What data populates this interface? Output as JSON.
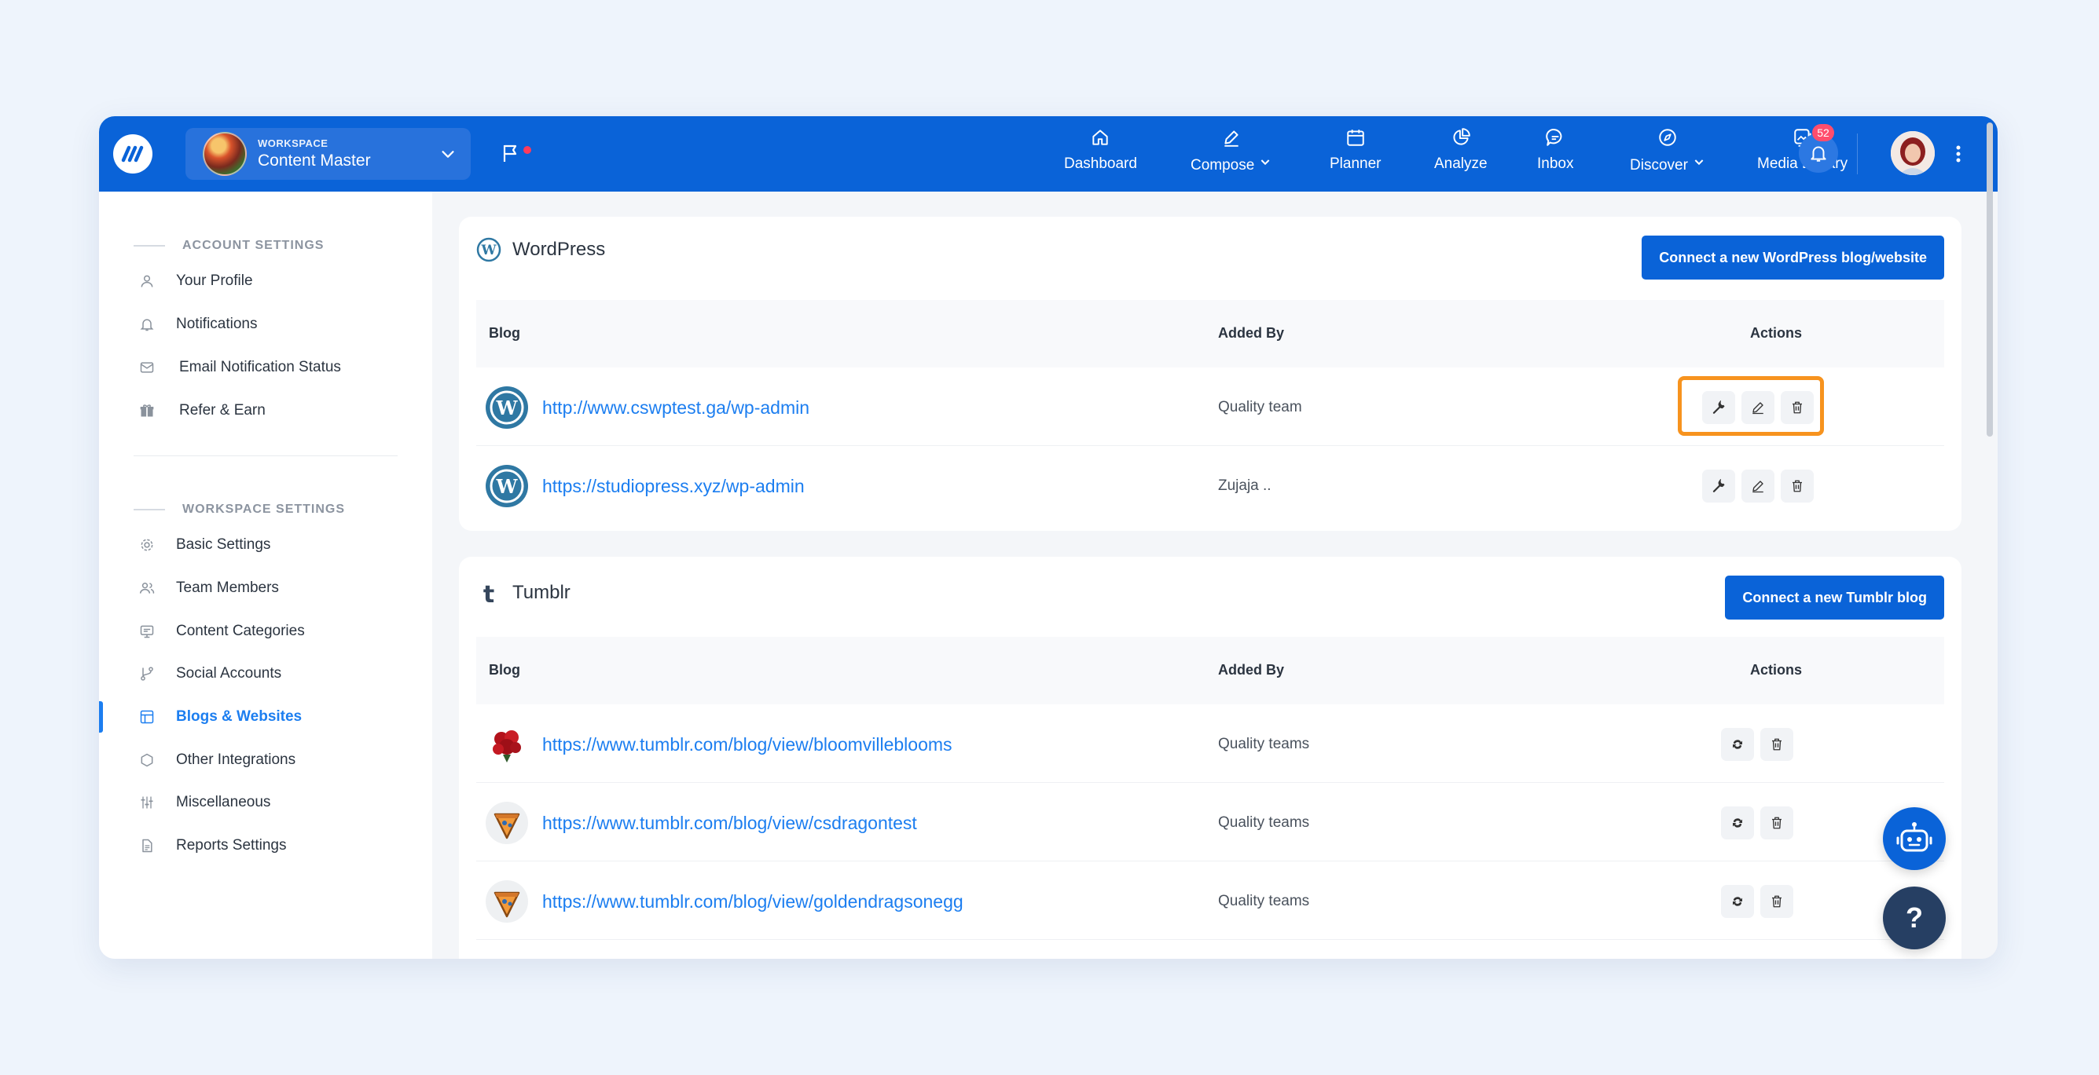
{
  "topbar": {
    "workspace_label": "WORKSPACE",
    "workspace_name": "Content Master",
    "nav": [
      {
        "label": "Dashboard",
        "icon": "home-icon"
      },
      {
        "label": "Compose",
        "icon": "pen-icon",
        "dropdown": true
      },
      {
        "label": "Planner",
        "icon": "calendar-icon"
      },
      {
        "label": "Analyze",
        "icon": "pie-chart-icon"
      },
      {
        "label": "Inbox",
        "icon": "chat-bubble-icon"
      },
      {
        "label": "Discover",
        "icon": "compass-icon",
        "dropdown": true
      },
      {
        "label": "Media Library",
        "icon": "images-icon"
      }
    ],
    "notifications_count": "52"
  },
  "sidebar": {
    "account_heading": "ACCOUNT SETTINGS",
    "account_items": [
      {
        "label": "Your Profile",
        "icon": "user-icon"
      },
      {
        "label": "Notifications",
        "icon": "bell-icon"
      },
      {
        "label": "Email Notification Status",
        "icon": "mail-icon"
      },
      {
        "label": "Refer & Earn",
        "icon": "gift-icon"
      }
    ],
    "workspace_heading": "WORKSPACE SETTINGS",
    "workspace_items": [
      {
        "label": "Basic Settings",
        "icon": "gear-icon"
      },
      {
        "label": "Team Members",
        "icon": "users-icon"
      },
      {
        "label": "Content Categories",
        "icon": "category-icon"
      },
      {
        "label": "Social Accounts",
        "icon": "branch-icon"
      },
      {
        "label": "Blogs & Websites",
        "icon": "layout-icon",
        "active": true
      },
      {
        "label": "Other Integrations",
        "icon": "hexagon-icon"
      },
      {
        "label": "Miscellaneous",
        "icon": "sliders-icon"
      },
      {
        "label": "Reports Settings",
        "icon": "document-icon"
      }
    ]
  },
  "wordpress": {
    "title": "WordPress",
    "connect_label": "Connect a new WordPress blog/website",
    "col_blog": "Blog",
    "col_added_by": "Added By",
    "col_actions": "Actions",
    "rows": [
      {
        "url": "http://www.cswptest.ga/wp-admin",
        "added_by": "Quality team"
      },
      {
        "url": "https://studiopress.xyz/wp-admin",
        "added_by": "Zujaja .."
      }
    ]
  },
  "tumblr": {
    "title": "Tumblr",
    "connect_label": "Connect a new Tumblr blog",
    "col_blog": "Blog",
    "col_added_by": "Added By",
    "col_actions": "Actions",
    "rows": [
      {
        "url": "https://www.tumblr.com/blog/view/bloomvilleblooms",
        "added_by": "Quality teams"
      },
      {
        "url": "https://www.tumblr.com/blog/view/csdragontest",
        "added_by": "Quality teams"
      },
      {
        "url": "https://www.tumblr.com/blog/view/goldendragsonegg",
        "added_by": "Quality teams"
      }
    ]
  },
  "help_label": "?",
  "colors": {
    "brand": "#0a63d8",
    "link": "#1c7ef0",
    "highlight": "#f7931e",
    "badge": "#ff4d6d"
  }
}
